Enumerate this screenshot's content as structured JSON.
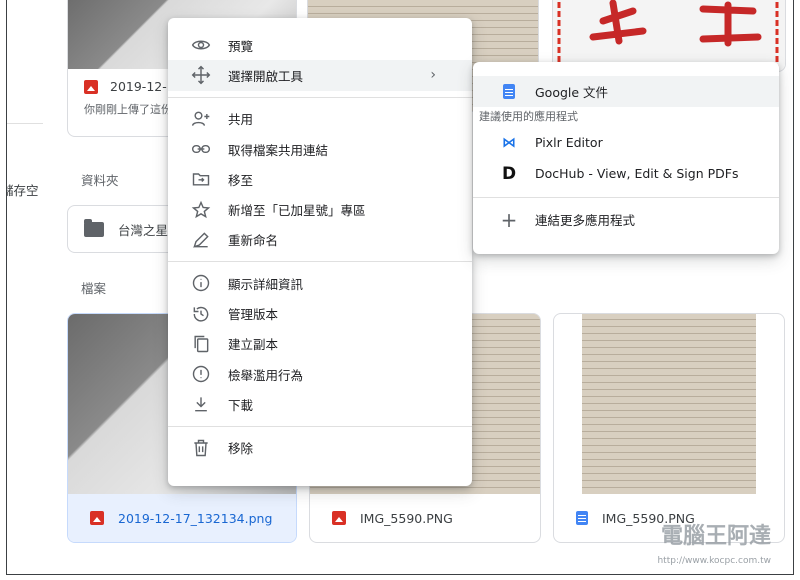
{
  "background": {
    "top_file_name": "2019-12-17",
    "top_file_sub": "你剛剛上傳了這份",
    "side_text": "儲存空",
    "folders_heading": "資料夾",
    "folder_name": "台灣之星",
    "files_heading": "檔案",
    "files": [
      {
        "name": "2019-12-17_132134.png",
        "selected": true
      },
      {
        "name": "IMG_5590.PNG",
        "selected": false
      },
      {
        "name": "IMG_5590.PNG",
        "selected": false
      }
    ]
  },
  "context_menu": {
    "items": [
      {
        "label": "預覽",
        "icon": "eye-icon"
      },
      {
        "label": "選擇開啟工具",
        "icon": "move-icon",
        "submenu": true
      },
      {
        "label": "共用",
        "icon": "add-person-icon"
      },
      {
        "label": "取得檔案共用連結",
        "icon": "link-icon"
      },
      {
        "label": "移至",
        "icon": "move-to-icon"
      },
      {
        "label": "新增至「已加星號」專區",
        "icon": "star-icon"
      },
      {
        "label": "重新命名",
        "icon": "pen-icon"
      },
      {
        "label": "顯示詳細資訊",
        "icon": "info-icon"
      },
      {
        "label": "管理版本",
        "icon": "history-icon"
      },
      {
        "label": "建立副本",
        "icon": "copy-icon"
      },
      {
        "label": "檢舉濫用行為",
        "icon": "report-icon"
      },
      {
        "label": "下載",
        "icon": "download-icon"
      },
      {
        "label": "移除",
        "icon": "trash-icon"
      }
    ]
  },
  "submenu": {
    "primary": "Google 文件",
    "suggested_heading": "建議使用的應用程式",
    "apps": [
      "Pixlr Editor",
      "DocHub - View, Edit & Sign PDFs"
    ],
    "connect_more": "連結更多應用程式"
  },
  "watermark": {
    "text": "電腦王阿達",
    "url": "http://www.kocpc.com.tw"
  }
}
